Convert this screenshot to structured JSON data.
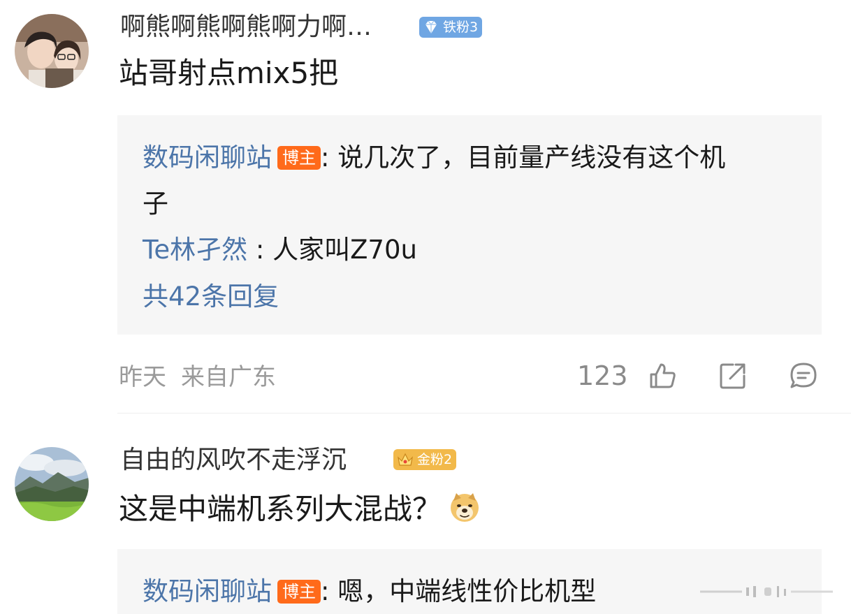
{
  "comments": [
    {
      "username": "啊熊啊熊啊熊啊力啊…",
      "fan_badge": "铁粉3",
      "text": "站哥射点mix5把",
      "replies": [
        {
          "author": "数码闲聊站",
          "host_tag": "博主",
          "sep": ": ",
          "text": "说几次了，目前量产线没有这个机",
          "text_cont": "子"
        },
        {
          "author": "Te林孑然",
          "sep": " : ",
          "text": "人家叫Z70u"
        }
      ],
      "more_replies": "共42条回复",
      "time": "昨天",
      "location": "来自广东",
      "like_count": "123"
    },
    {
      "username": "自由的风吹不走浮沉",
      "fan_badge": "金粉2",
      "text": "这是中端机系列大混战？",
      "replies": [
        {
          "author": "数码闲聊站",
          "host_tag": "博主",
          "sep": ": ",
          "text": "嗯，中端线性价比机型"
        }
      ]
    }
  ],
  "icons": {
    "like": "thumbs-up-icon",
    "share": "share-icon",
    "reply": "comment-icon",
    "iron_badge": "diamond-icon",
    "gold_badge": "crown-icon",
    "emoji": "doge-emoji"
  },
  "colors": {
    "link_blue": "#4c75a9",
    "host_orange": "#ff6a1a",
    "reply_bg": "#f6f6f6",
    "meta_gray": "#9a9a9a"
  }
}
